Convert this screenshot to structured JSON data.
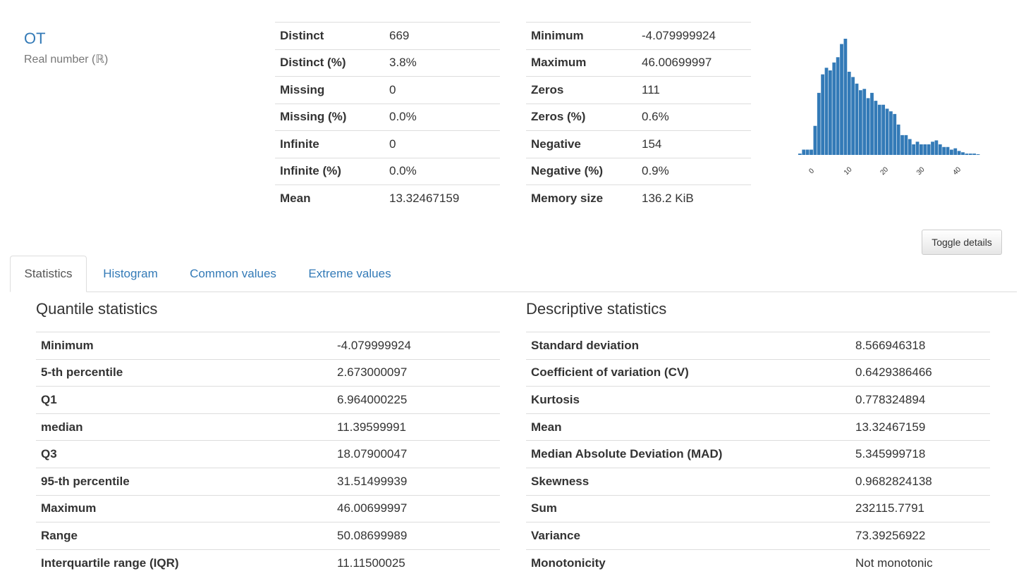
{
  "variable": {
    "name": "OT",
    "type": "Real number (ℝ)"
  },
  "overview_left": [
    {
      "label": "Distinct",
      "value": "669"
    },
    {
      "label": "Distinct (%)",
      "value": "3.8%"
    },
    {
      "label": "Missing",
      "value": "0"
    },
    {
      "label": "Missing (%)",
      "value": "0.0%"
    },
    {
      "label": "Infinite",
      "value": "0"
    },
    {
      "label": "Infinite (%)",
      "value": "0.0%"
    },
    {
      "label": "Mean",
      "value": "13.32467159"
    }
  ],
  "overview_right": [
    {
      "label": "Minimum",
      "value": "-4.079999924"
    },
    {
      "label": "Maximum",
      "value": "46.00699997"
    },
    {
      "label": "Zeros",
      "value": "111"
    },
    {
      "label": "Zeros (%)",
      "value": "0.6%"
    },
    {
      "label": "Negative",
      "value": "154"
    },
    {
      "label": "Negative (%)",
      "value": "0.9%"
    },
    {
      "label": "Memory size",
      "value": "136.2 KiB"
    }
  ],
  "chart_data": {
    "type": "bar",
    "xlim": [
      -4.08,
      46.01
    ],
    "x_ticks": [
      "0",
      "10",
      "20",
      "30",
      "40"
    ],
    "values": [
      1,
      4,
      4,
      4,
      22,
      47,
      61,
      66,
      64,
      70,
      74,
      84,
      88,
      63,
      59,
      54,
      49,
      50,
      43,
      47,
      41,
      38,
      38,
      35,
      33,
      31,
      23,
      15,
      15,
      12,
      8,
      10,
      8,
      8,
      8,
      10,
      11,
      8,
      6,
      6,
      4,
      5,
      3,
      2,
      1,
      1,
      1,
      0.5
    ],
    "color": "#337ab7"
  },
  "toggle_label": "Toggle details",
  "tabs": [
    "Statistics",
    "Histogram",
    "Common values",
    "Extreme values"
  ],
  "quantile": {
    "title": "Quantile statistics",
    "rows": [
      {
        "label": "Minimum",
        "value": "-4.079999924"
      },
      {
        "label": "5-th percentile",
        "value": "2.673000097"
      },
      {
        "label": "Q1",
        "value": "6.964000225"
      },
      {
        "label": "median",
        "value": "11.39599991"
      },
      {
        "label": "Q3",
        "value": "18.07900047"
      },
      {
        "label": "95-th percentile",
        "value": "31.51499939"
      },
      {
        "label": "Maximum",
        "value": "46.00699997"
      },
      {
        "label": "Range",
        "value": "50.08699989"
      },
      {
        "label": "Interquartile range (IQR)",
        "value": "11.11500025"
      }
    ]
  },
  "descriptive": {
    "title": "Descriptive statistics",
    "rows": [
      {
        "label": "Standard deviation",
        "value": "8.566946318"
      },
      {
        "label": "Coefficient of variation (CV)",
        "value": "0.6429386466"
      },
      {
        "label": "Kurtosis",
        "value": "0.778324894"
      },
      {
        "label": "Mean",
        "value": "13.32467159"
      },
      {
        "label": "Median Absolute Deviation (MAD)",
        "value": "5.345999718"
      },
      {
        "label": "Skewness",
        "value": "0.9682824138"
      },
      {
        "label": "Sum",
        "value": "232115.7791"
      },
      {
        "label": "Variance",
        "value": "73.39256922"
      },
      {
        "label": "Monotonicity",
        "value": "Not monotonic"
      }
    ]
  }
}
